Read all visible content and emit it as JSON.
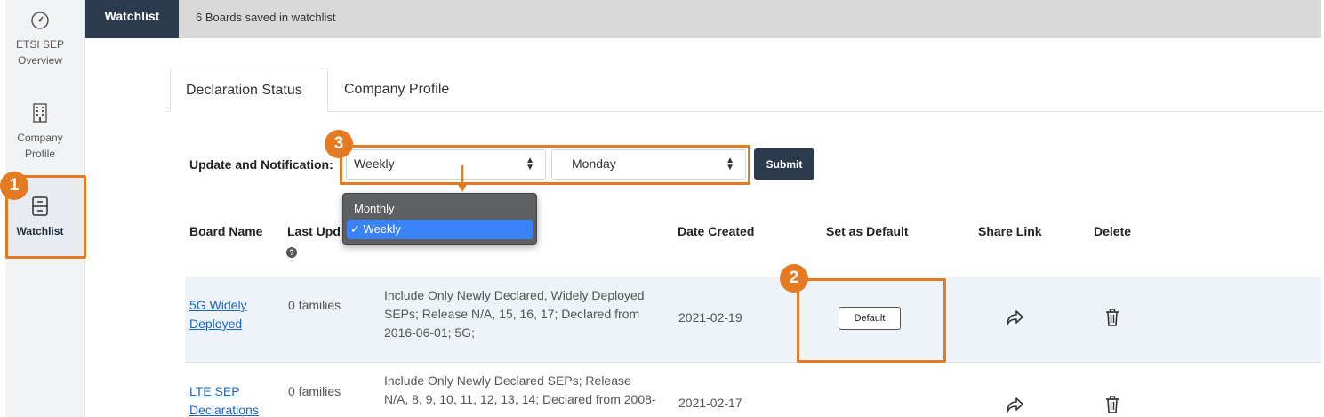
{
  "sidebar": {
    "items": [
      {
        "label_line1": "ETSI SEP",
        "label_line2": "Overview",
        "icon": "speedometer-icon"
      },
      {
        "label_line1": "Company",
        "label_line2": "Profile",
        "icon": "building-icon"
      },
      {
        "label_line1": "Watchlist",
        "label_line2": "",
        "icon": "cabinet-icon"
      }
    ]
  },
  "header": {
    "tab_label": "Watchlist",
    "status": "6 Boards saved in watchlist"
  },
  "tabs": [
    {
      "label": "Declaration Status",
      "active": true
    },
    {
      "label": "Company Profile",
      "active": false
    }
  ],
  "notification": {
    "label": "Update and Notification:",
    "frequency_value": "Weekly",
    "day_value": "Monday",
    "submit_label": "Submit",
    "dropdown_options": [
      "Monthly",
      "Weekly"
    ],
    "dropdown_selected_marker": "✓"
  },
  "table": {
    "headers": {
      "board_name": "Board Name",
      "last_updated": "Last Upd",
      "date_created": "Date Created",
      "set_default": "Set as Default",
      "share_link": "Share Link",
      "delete": "Delete"
    },
    "rows": [
      {
        "board_line1": "5G Widely",
        "board_line2": "Deployed",
        "families": "0  families",
        "desc_line1": "Include Only Newly Declared, Widely Deployed",
        "desc_line2": "SEPs; Release N/A, 15, 16, 17; Declared from",
        "desc_line3": "2016-06-01; 5G;",
        "date_created": "2021-02-19",
        "default_label": "Default"
      },
      {
        "board_line1": "LTE SEP",
        "board_line2": "Declarations",
        "families": "0  families",
        "desc_line1": "Include Only Newly Declared SEPs; Release",
        "desc_line2": "N/A, 8, 9, 10, 11, 12, 13, 14; Declared from 2008-",
        "date_created": "2021-02-17"
      }
    ]
  },
  "annotations": {
    "badge1": "1",
    "badge2": "2",
    "badge3": "3",
    "accent_color": "#e47a21"
  },
  "colors": {
    "dark_navy": "#2b3a4d",
    "link_blue": "#1a66c5",
    "row_highlight": "#eef3f8"
  }
}
